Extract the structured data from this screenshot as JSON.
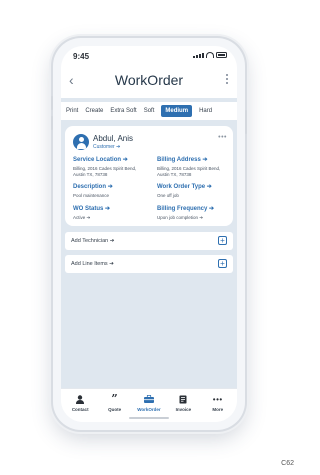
{
  "status": {
    "time": "9:45"
  },
  "header": {
    "back": "‹",
    "title": "WorkOrder"
  },
  "tabs": [
    {
      "label": "Print"
    },
    {
      "label": "Create"
    },
    {
      "label": "Extra Soft"
    },
    {
      "label": "Soft"
    },
    {
      "label": "Medium",
      "active": true
    },
    {
      "label": "Hard"
    }
  ],
  "customer": {
    "name": "Abdul, Anis",
    "type_label": "Customer",
    "more": "•••"
  },
  "fields": {
    "service_location": {
      "label": "Service Location",
      "value": "Billing, 2016 Cades Spirit Bend, Austin TX, 78738"
    },
    "billing_address": {
      "label": "Billing Address",
      "value": "Billing, 2016 Cades Spirit Bend, Austin TX, 78738"
    },
    "description": {
      "label": "Description",
      "value": "Pool maintenance"
    },
    "work_order_type": {
      "label": "Work Order Type",
      "value": "One off job"
    },
    "wo_status": {
      "label": "WO Status",
      "value": "Active"
    },
    "billing_frequency": {
      "label": "Billing Frequency",
      "value": "Upon job completion"
    }
  },
  "add_rows": {
    "technician": "Add Technician",
    "line_items": "Add Line Items"
  },
  "bottom_nav": [
    {
      "label": "Contact",
      "icon": "person-icon"
    },
    {
      "label": "Quote",
      "icon": "quote-icon"
    },
    {
      "label": "WorkOrder",
      "icon": "briefcase-icon",
      "active": true
    },
    {
      "label": "Invoice",
      "icon": "invoice-icon"
    },
    {
      "label": "More",
      "icon": "more-dots-icon"
    }
  ],
  "corner_label": "C62",
  "colors": {
    "accent": "#2e6fb0",
    "background": "#dfe7ef"
  }
}
